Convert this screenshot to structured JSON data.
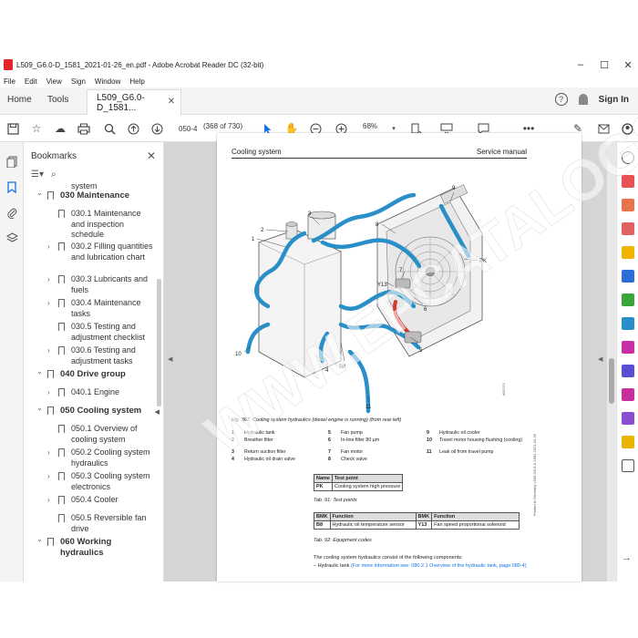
{
  "window": {
    "title": "L509_G6.0-D_1581_2021-01-26_en.pdf - Adobe Acrobat Reader DC (32-bit)",
    "controls": [
      "–",
      "☐",
      "✕"
    ]
  },
  "menubar": [
    "File",
    "Edit",
    "View",
    "Sign",
    "Window",
    "Help"
  ],
  "tabs": {
    "home": "Home",
    "tools": "Tools",
    "document": "L509_G6.0-D_1581..."
  },
  "header_right": {
    "help": "?",
    "signin": "Sign In"
  },
  "toolbar": {
    "page_input": "050-4",
    "page_count": "(368 of 730)",
    "zoom": "68%"
  },
  "bookmarks": {
    "title": "Bookmarks",
    "items": [
      {
        "label": "system",
        "level": 2,
        "bold": false,
        "chevron": ""
      },
      {
        "label": "030 Maintenance",
        "level": 1,
        "bold": true,
        "chevron": "open"
      },
      {
        "label": "030.1 Maintenance and inspection schedule",
        "level": 2,
        "bold": false,
        "chevron": ""
      },
      {
        "label": "030.2 Filling quantities and lubrication chart",
        "level": 2,
        "bold": false,
        "chevron": "closed"
      },
      {
        "label": "030.3 Lubricants and fuels",
        "level": 2,
        "bold": false,
        "chevron": "closed"
      },
      {
        "label": "030.4 Maintenance tasks",
        "level": 2,
        "bold": false,
        "chevron": "closed"
      },
      {
        "label": "030.5 Testing and adjustment checklist",
        "level": 2,
        "bold": false,
        "chevron": ""
      },
      {
        "label": "030.6 Testing and adjustment tasks",
        "level": 2,
        "bold": false,
        "chevron": "closed"
      },
      {
        "label": "040 Drive group",
        "level": 1,
        "bold": true,
        "chevron": "open"
      },
      {
        "label": "040.1 Engine",
        "level": 2,
        "bold": false,
        "chevron": "closed"
      },
      {
        "label": "050 Cooling system",
        "level": 1,
        "bold": true,
        "chevron": "open"
      },
      {
        "label": "050.1 Overview of cooling system",
        "level": 2,
        "bold": false,
        "chevron": ""
      },
      {
        "label": "050.2 Cooling system hydraulics",
        "level": 2,
        "bold": false,
        "chevron": "closed"
      },
      {
        "label": "050.3 Cooling system electronics",
        "level": 2,
        "bold": false,
        "chevron": "closed"
      },
      {
        "label": "050.4 Cooler",
        "level": 2,
        "bold": false,
        "chevron": "closed"
      },
      {
        "label": "050.5 Reversible fan drive",
        "level": 2,
        "bold": false,
        "chevron": ""
      },
      {
        "label": "060 Working hydraulics",
        "level": 1,
        "bold": true,
        "chevron": "open"
      }
    ]
  },
  "page": {
    "header_left": "Cooling system",
    "header_right": "Service manual",
    "fig_caption": "Fig. 367: Cooling system hydraulics (diesel engine is running) (from rear left)",
    "fig_code": "d051515",
    "fig_labels": [
      "1",
      "2",
      "3",
      "4",
      "5",
      "6",
      "7",
      "8",
      "9",
      "10",
      "11",
      "Y13",
      "B8",
      "PK"
    ],
    "legend": [
      {
        "n": "1",
        "t": "Hydraulic tank"
      },
      {
        "n": "2",
        "t": "Breather filter"
      },
      {
        "n": "3",
        "t": "Return suction filter"
      },
      {
        "n": "4",
        "t": "Hydraulic oil drain valve"
      },
      {
        "n": "5",
        "t": "Fan pump"
      },
      {
        "n": "6",
        "t": "In-line filter 80 µm"
      },
      {
        "n": "7",
        "t": "Fan motor"
      },
      {
        "n": "8",
        "t": "Check valve"
      },
      {
        "n": "9",
        "t": "Hydraulic oil cooler"
      },
      {
        "n": "10",
        "t": "Travel motor housing flushing (cooling)"
      },
      {
        "n": "11",
        "t": "Leak oil from travel pump"
      }
    ],
    "table1": {
      "headers": [
        "Name",
        "Test point"
      ],
      "rows": [
        [
          "PK",
          "Cooling system high pressure"
        ]
      ],
      "caption": "Tab. 91: Test points"
    },
    "table2": {
      "headers": [
        "BMK",
        "Function",
        "BMK",
        "Function"
      ],
      "rows": [
        [
          "B8",
          "Hydraulic oil temperature sensor",
          "Y13",
          "Fan speed proportional solenoid"
        ]
      ],
      "caption": "Tab. 92: Equipment codes"
    },
    "body_text": "The cooling system hydraulics consist of the following components:",
    "body_item_prefix": "–  Hydraulic tank ",
    "body_item_link": "(For more information see: 080.2.1 Overview of the hydraulic tank, page 080-4)",
    "side_code": "Printed in Germany  L509 G6.0-D 1581  2021-01-26",
    "watermark": "WWW.EPCATALOGS.COM"
  },
  "colors": {
    "accent": "#1473e6",
    "acrobat_red": "#e5252a",
    "hydraulic_blue": "#2a8fc8",
    "pressure_red": "#d23a2a",
    "watermark": "#ffffff"
  }
}
